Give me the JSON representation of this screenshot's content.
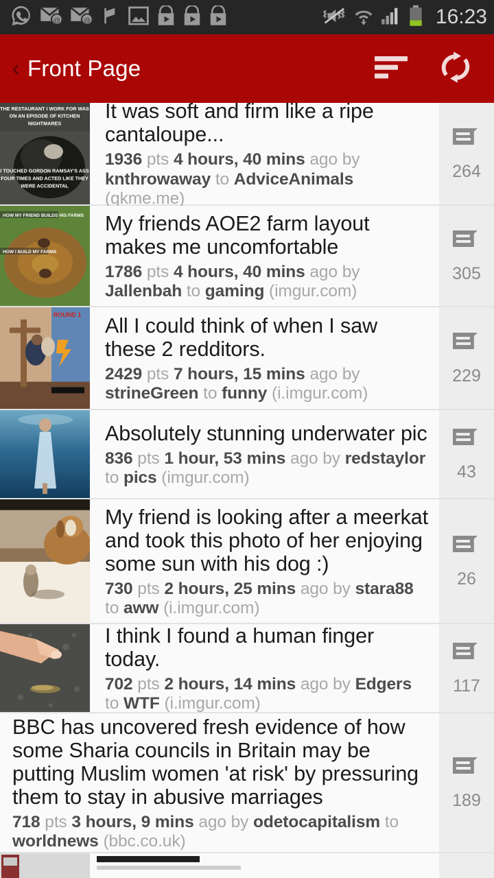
{
  "status_bar": {
    "time": "16:23",
    "icons": [
      "whatsapp-icon",
      "email-icon",
      "email-icon",
      "flag-icon",
      "gallery-image-icon",
      "play-store-icon",
      "play-store-icon",
      "play-store-icon",
      "vibrate-mute-icon",
      "wifi-icon",
      "cellular-signal-icon",
      "battery-icon"
    ],
    "background_color": "#262626"
  },
  "action_bar": {
    "back_label": "‹",
    "title": "Front Page",
    "sort_icon": "sort-icon",
    "refresh_icon": "refresh-icon",
    "background_color": "#ab0606"
  },
  "posts": [
    {
      "title": "It was soft and firm like a ripe cantaloupe...",
      "points": "1936",
      "points_unit": "pts",
      "age": "4 hours, 40 mins",
      "ago_by": "ago by",
      "author": "knthrowaway",
      "to": "to",
      "subreddit": "AdviceAnimals",
      "domain": "(qkme.me)",
      "comments": "264",
      "thumbnail": "bear-meme-thumbnail"
    },
    {
      "title": "My friends AOE2 farm layout makes me uncomfortable",
      "points": "1786",
      "points_unit": "pts",
      "age": "4 hours, 40 mins",
      "ago_by": "ago by",
      "author": "Jallenbah",
      "to": "to",
      "subreddit": "gaming",
      "domain": "(imgur.com)",
      "comments": "305",
      "thumbnail": "aoe2-farm-thumbnail"
    },
    {
      "title": "All I could think of when I saw these 2 redditors.",
      "points": "2429",
      "points_unit": "pts",
      "age": "7 hours, 15 mins",
      "ago_by": "ago by",
      "author": "strineGreen",
      "to": "to",
      "subreddit": "funny",
      "domain": "(i.imgur.com)",
      "comments": "229",
      "thumbnail": "versus-meme-thumbnail"
    },
    {
      "title": "Absolutely stunning underwater pic",
      "points": "836",
      "points_unit": "pts",
      "age": "1 hour, 53 mins",
      "ago_by": "ago by",
      "author": "redstaylor",
      "to": "to",
      "subreddit": "pics",
      "domain": "(imgur.com)",
      "comments": "43",
      "thumbnail": "underwater-woman-thumbnail"
    },
    {
      "title": "My friend is looking after a meerkat and took this photo of her enjoying some sun with his dog :)",
      "points": "730",
      "points_unit": "pts",
      "age": "2 hours, 25 mins",
      "ago_by": "ago by",
      "author": "stara88",
      "to": "to",
      "subreddit": "aww",
      "domain": "(i.imgur.com)",
      "comments": "26",
      "thumbnail": "dog-meerkat-thumbnail"
    },
    {
      "title": "I think I found a human finger today.",
      "points": "702",
      "points_unit": "pts",
      "age": "2 hours, 14 mins",
      "ago_by": "ago by",
      "author": "Edgers",
      "to": "to",
      "subreddit": "WTF",
      "domain": "(i.imgur.com)",
      "comments": "117",
      "thumbnail": "finger-asphalt-thumbnail"
    },
    {
      "title": "BBC has uncovered fresh evidence of how some Sharia councils in Britain may be putting Muslim women 'at risk' by pressuring them to stay in abusive marriages",
      "points": "718",
      "points_unit": "pts",
      "age": "3 hours, 9 mins",
      "ago_by": "ago by",
      "author": "odetocapitalism",
      "to": "to",
      "subreddit": "worldnews",
      "domain": "(bbc.co.uk)",
      "comments": "189",
      "thumbnail": null
    }
  ],
  "colors": {
    "accent_red": "#ab0606",
    "status_bar": "#262626",
    "list_background": "#fafafa",
    "comment_column": "#ededed",
    "title_text": "#1b1b1b",
    "meta_text": "#9b9b9b",
    "meta_strong": "#4c4c4c"
  }
}
